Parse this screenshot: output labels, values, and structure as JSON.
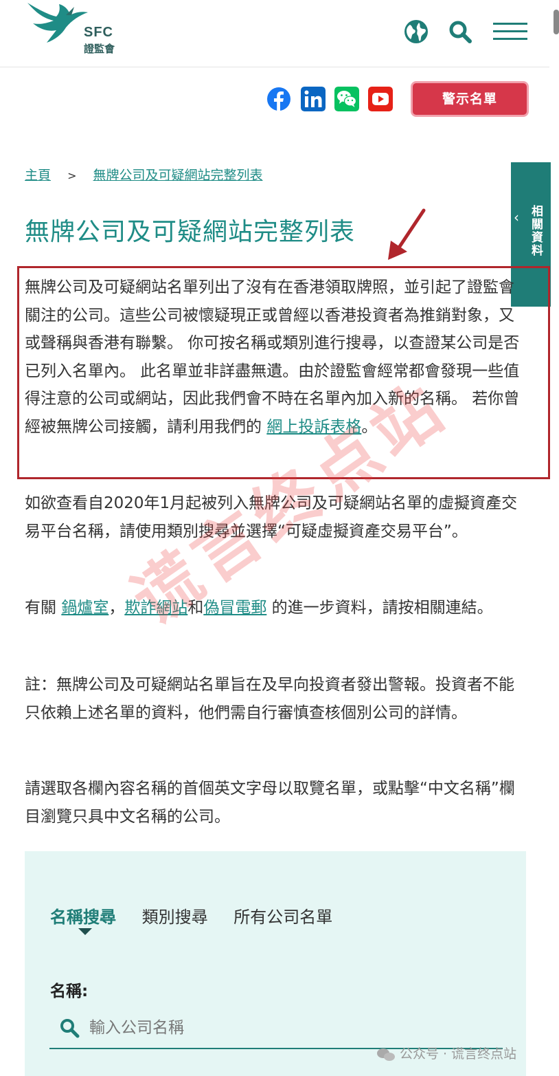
{
  "header": {
    "logo_en": "SFC",
    "logo_zh": "證監會",
    "icons": [
      "globe-icon",
      "search-icon",
      "menu-icon"
    ]
  },
  "social": {
    "icons": [
      "facebook-icon",
      "linkedin-icon",
      "wechat-icon",
      "youtube-icon"
    ],
    "warning_button": "警示名單"
  },
  "breadcrumb": {
    "home": "主頁",
    "separator": ">",
    "current": "無牌公司及可疑網站完整列表"
  },
  "side_tab": {
    "label": "相關資料"
  },
  "page_title": "無牌公司及可疑網站完整列表",
  "intro": {
    "text": "無牌公司及可疑網站名單列出了沒有在香港領取牌照，並引起了證監會關注的公司。這些公司被懷疑現正或曾經以香港投資者為推銷對象，又或聲稱與香港有聯繫。 你可按名稱或類別進行搜尋，以查證某公司是否已列入名單內。 此名單並非詳盡無遺。由於證監會經常都會發現一些值得注意的公司或網站，因此我們會不時在名單內加入新的名稱。 若你曾經被無牌公司接觸，請利用我們的",
    "link": "網上投訴表格",
    "tail": "。"
  },
  "virtual_assets": {
    "text": "如欲查看自2020年1月起被列入無牌公司及可疑網站名單的虛擬資產交易平台名稱，請使用類別搜尋並選擇“可疑虛擬資產交易平台”。"
  },
  "related": {
    "prefix": "有關",
    "link1": "鍋爐室",
    "sep1": "，",
    "link2": "欺詐網站",
    "sep2": "和",
    "link3": "偽冒電郵",
    "suffix": "的進一步資料，請按相關連結。"
  },
  "note": {
    "text": "註：無牌公司及可疑網站名單旨在及早向投資者發出警報。投資者不能只依賴上述名單的資料，他們需自行審慎查核個別公司的詳情。"
  },
  "instruction": {
    "text": "請選取各欄內容名稱的首個英文字母以取覽名單，或點擊“中文名稱”欄目瀏覽只具中文名稱的公司。"
  },
  "search": {
    "tabs": [
      "名稱搜尋",
      "類別搜尋",
      "所有公司名單"
    ],
    "active_tab": "名稱搜尋",
    "name_label": "名稱:",
    "placeholder": "輸入公司名稱"
  },
  "watermark": {
    "text": "谎言终点站",
    "footer": "公众号 · 谎言终点站"
  },
  "colors": {
    "brand_teal": "#1f8c86",
    "warning_red": "#d6374a",
    "highlight_red": "#b0262c",
    "panel_bg": "#e5f6f4"
  }
}
